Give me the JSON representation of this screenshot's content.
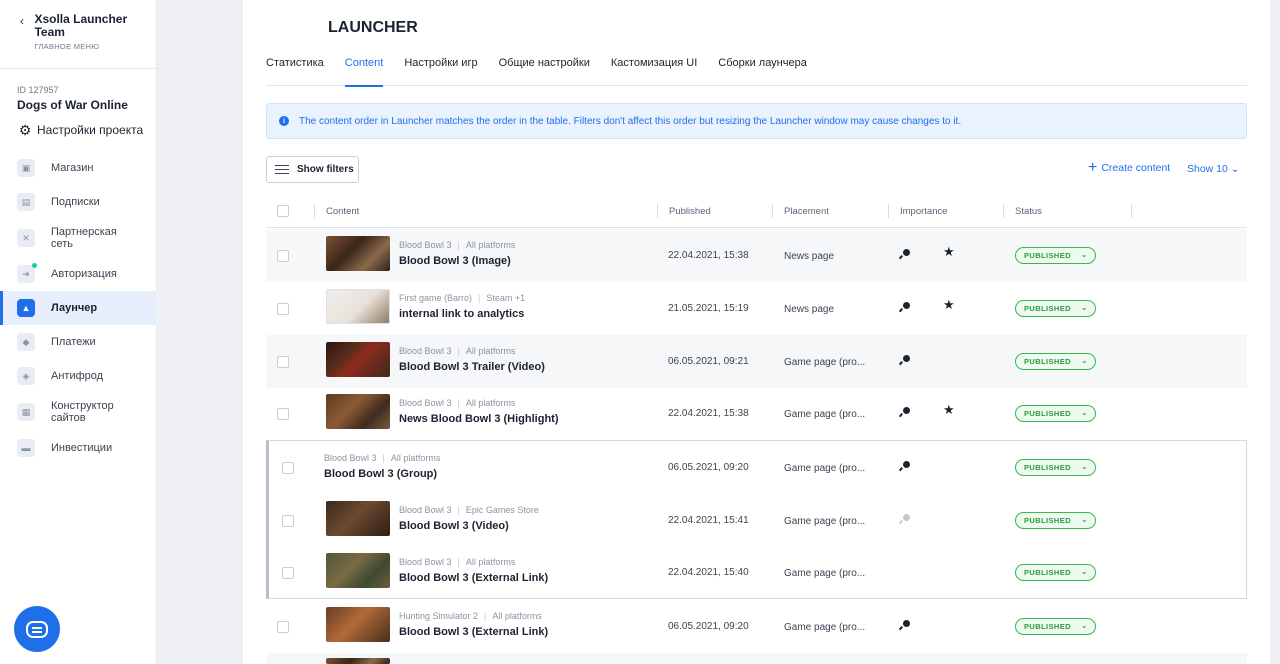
{
  "sidebar": {
    "back_glyph": "‹",
    "team_name": "Xsolla Launcher Team",
    "team_sub": "ГЛАВНОЕ МЕНЮ",
    "project_id": "ID 127957",
    "project_name": "Dogs of War Online",
    "project_settings": "Настройки проекта",
    "items": [
      {
        "label": "Магазин",
        "icon": "cart-icon"
      },
      {
        "label": "Подписки",
        "icon": "subscriptions-icon"
      },
      {
        "label": "Партнерская сеть",
        "icon": "partner-network-icon"
      },
      {
        "label": "Авторизация",
        "icon": "login-icon"
      },
      {
        "label": "Лаунчер",
        "icon": "launcher-icon",
        "active": true
      },
      {
        "label": "Платежи",
        "icon": "payments-icon"
      },
      {
        "label": "Антифрод",
        "icon": "antifraud-icon"
      },
      {
        "label": "Конструктор сайтов",
        "icon": "site-builder-icon"
      },
      {
        "label": "Инвестиции",
        "icon": "investments-icon"
      }
    ]
  },
  "page": {
    "title": "LAUNCHER",
    "tabs": [
      "Статистика",
      "Content",
      "Настройки игр",
      "Общие настройки",
      "Кастомизация UI",
      "Сборки лаунчера"
    ],
    "active_tab": "Content",
    "banner": "The content order in Launcher matches the order in the table. Filters don't affect this order but resizing the Launcher window may cause changes to it.",
    "show_filters": "Show filters",
    "create_content": "Create content",
    "show_select": "Show 10"
  },
  "table": {
    "headers": {
      "content": "Content",
      "published": "Published",
      "placement": "Placement",
      "importance": "Importance",
      "status": "Status"
    },
    "status_chevron": "⌄",
    "star_glyph": "★",
    "rows": [
      {
        "game": "Blood Bowl 3",
        "platform": "All platforms",
        "name": "Blood Bowl 3 (Image)",
        "published": "22.04.2021, 15:38",
        "placement": "News page",
        "status": "PUBLISHED"
      },
      {
        "game": "First game (Barro)",
        "platform": "Steam +1",
        "name": "internal link to analytics",
        "published": "21.05.2021, 15:19",
        "placement": "News page",
        "status": "PUBLISHED"
      },
      {
        "game": "Blood Bowl 3",
        "platform": "All platforms",
        "name": "Blood Bowl 3 Trailer (Video)",
        "published": "06.05.2021, 09:21",
        "placement": "Game page (pro...",
        "status": "PUBLISHED"
      },
      {
        "game": "Blood Bowl 3",
        "platform": "All platforms",
        "name": "News Blood Bowl 3 (Highlight)",
        "published": "22.04.2021, 15:38",
        "placement": "Game page (pro...",
        "status": "PUBLISHED"
      },
      {
        "game": "Blood Bowl 3",
        "platform": "All platforms",
        "name": "Blood Bowl 3 (Group)",
        "published": "06.05.2021, 09:20",
        "placement": "Game page (pro...",
        "status": "PUBLISHED"
      },
      {
        "game": "Blood Bowl 3",
        "platform": "Epic Games Store",
        "name": "Blood Bowl 3 (Video)",
        "published": "22.04.2021, 15:41",
        "placement": "Game page (pro...",
        "status": "PUBLISHED"
      },
      {
        "game": "Blood Bowl 3",
        "platform": "All platforms",
        "name": "Blood Bowl 3 (External Link)",
        "published": "22.04.2021, 15:40",
        "placement": "Game page (pro...",
        "status": "PUBLISHED"
      },
      {
        "game": "Hunting Simulator 2",
        "platform": "All platforms",
        "name": "Blood Bowl 3 (External Link)",
        "published": "06.05.2021, 09:20",
        "placement": "Game page (pro...",
        "status": "PUBLISHED"
      }
    ]
  }
}
